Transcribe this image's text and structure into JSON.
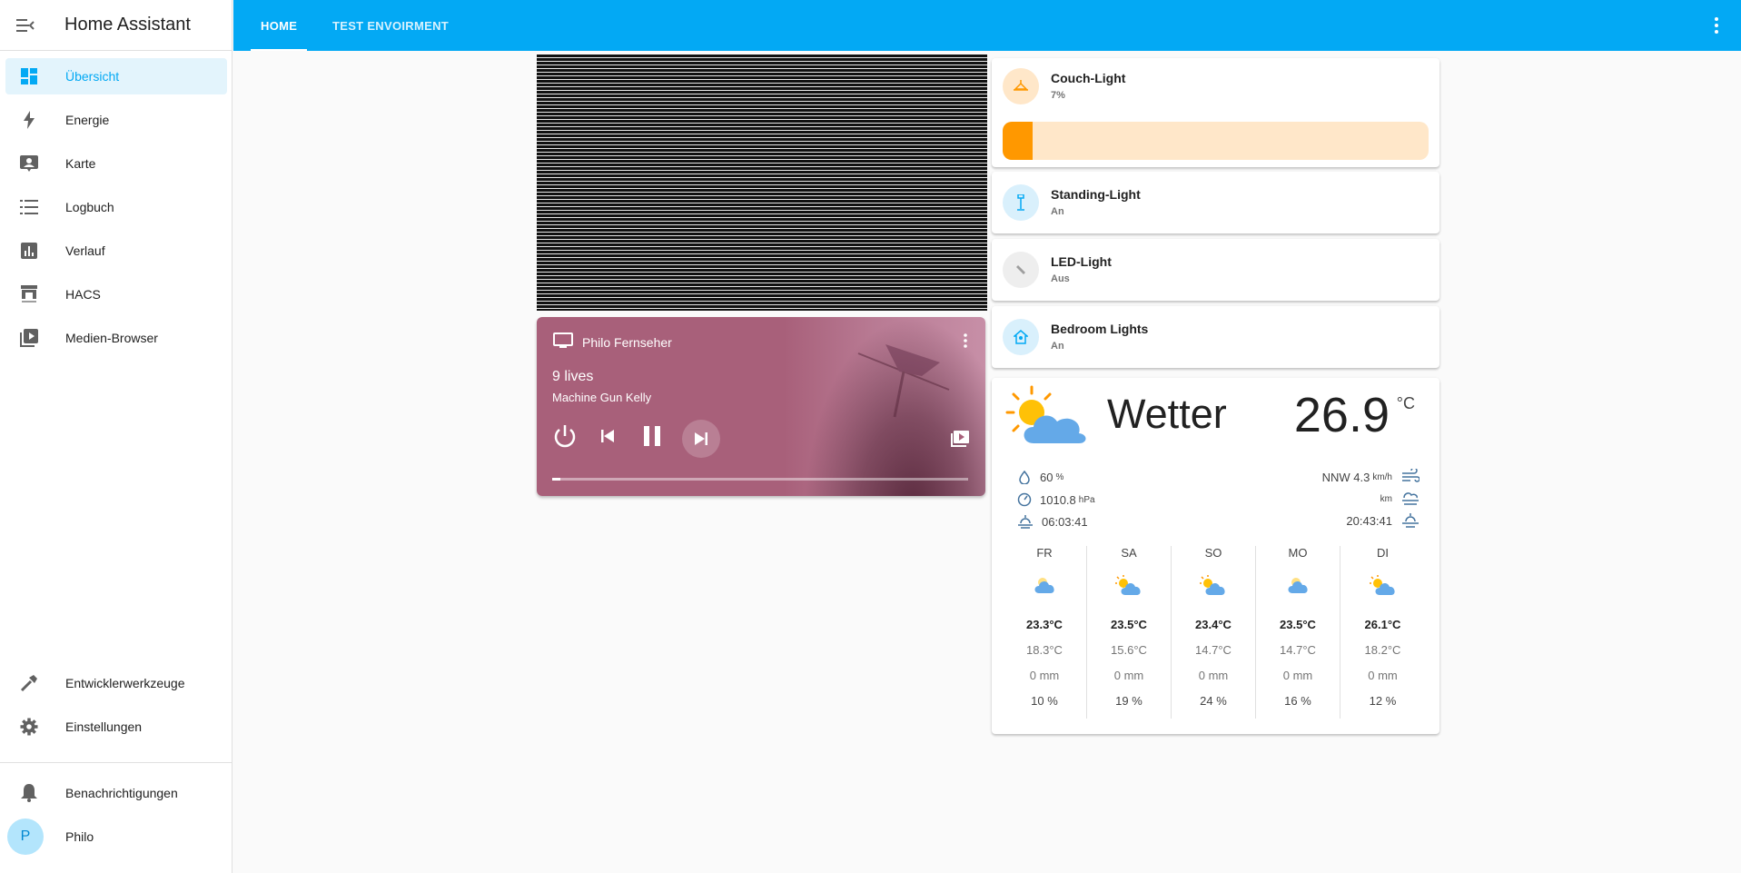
{
  "app": {
    "title": "Home Assistant"
  },
  "sidebar": {
    "items": [
      {
        "label": "Übersicht",
        "icon": "dashboard-icon",
        "active": true
      },
      {
        "label": "Energie",
        "icon": "lightning-icon"
      },
      {
        "label": "Karte",
        "icon": "map-person-icon"
      },
      {
        "label": "Logbuch",
        "icon": "list-icon"
      },
      {
        "label": "Verlauf",
        "icon": "chart-icon"
      },
      {
        "label": "HACS",
        "icon": "hacs-icon"
      },
      {
        "label": "Medien-Browser",
        "icon": "media-icon"
      }
    ],
    "bottom_items": [
      {
        "label": "Entwicklerwerkzeuge",
        "icon": "hammer-icon"
      },
      {
        "label": "Einstellungen",
        "icon": "gear-icon"
      }
    ],
    "notifications": {
      "label": "Benachrichtigungen",
      "icon": "bell-icon"
    },
    "user": {
      "name": "Philo",
      "initial": "P"
    }
  },
  "header": {
    "tabs": [
      {
        "label": "HOME",
        "active": true
      },
      {
        "label": "TEST ENVOIRMENT"
      }
    ]
  },
  "media_player": {
    "device": "Philo Fernseher",
    "title": "9 lives",
    "artist": "Machine Gun Kelly",
    "progress": 0.02
  },
  "entities": [
    {
      "name": "Couch-Light",
      "state": "7%",
      "brightness": 0.07,
      "icon": "ceiling-lamp-icon",
      "color": "#ff9800"
    },
    {
      "name": "Standing-Light",
      "state": "An",
      "icon": "floor-lamp-icon",
      "color": "#03a9f4"
    },
    {
      "name": "LED-Light",
      "state": "Aus",
      "icon": "led-strip-icon",
      "color": "#9e9e9e"
    },
    {
      "name": "Bedroom Lights",
      "state": "An",
      "icon": "home-light-icon",
      "color": "#03a9f4"
    }
  ],
  "weather": {
    "condition": "Wetter",
    "temperature": "26.9",
    "unit": "°C",
    "humidity": "60",
    "humidity_unit": "%",
    "pressure": "1010.8",
    "pressure_unit": "hPa",
    "sunrise": "06:03:41",
    "wind": "NNW 4.3",
    "wind_unit": "km/h",
    "visibility_unit": "km",
    "sunset": "20:43:41",
    "forecast": [
      {
        "day": "FR",
        "icon": "cloudy-icon",
        "high": "23.3°C",
        "low": "18.3°C",
        "precip": "0 mm",
        "prob": "10 %"
      },
      {
        "day": "SA",
        "icon": "partly-cloudy-icon",
        "high": "23.5°C",
        "low": "15.6°C",
        "precip": "0 mm",
        "prob": "19 %"
      },
      {
        "day": "SO",
        "icon": "partly-cloudy-icon",
        "high": "23.4°C",
        "low": "14.7°C",
        "precip": "0 mm",
        "prob": "24 %"
      },
      {
        "day": "MO",
        "icon": "cloudy-icon",
        "high": "23.5°C",
        "low": "14.7°C",
        "precip": "0 mm",
        "prob": "16 %"
      },
      {
        "day": "DI",
        "icon": "partly-cloudy-icon",
        "high": "26.1°C",
        "low": "18.2°C",
        "precip": "0 mm",
        "prob": "12 %"
      }
    ]
  },
  "colors": {
    "primary": "#03a9f4",
    "accent": "#ff9800",
    "sidebar_icon": "#616161"
  }
}
